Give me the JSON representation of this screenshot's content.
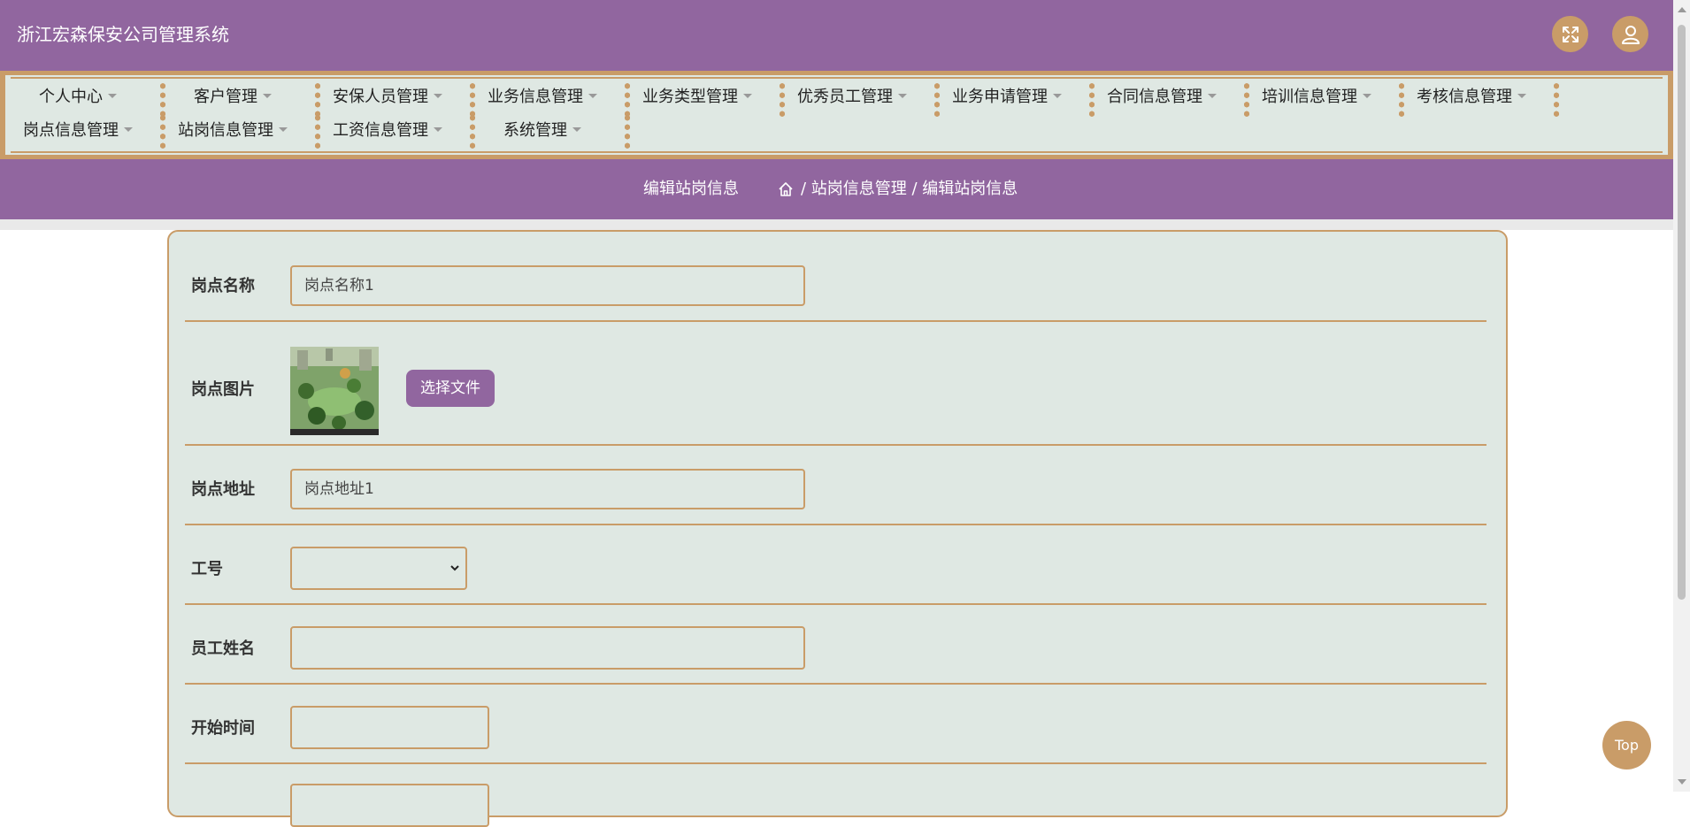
{
  "header": {
    "title": "浙江宏森保安公司管理系统",
    "fullscreen_icon": "expand-icon",
    "user_icon": "user-icon"
  },
  "nav": {
    "row1": [
      "个人中心",
      "客户管理",
      "安保人员管理",
      "业务信息管理",
      "业务类型管理",
      "优秀员工管理",
      "业务申请管理",
      "合同信息管理",
      "培训信息管理",
      "考核信息管理"
    ],
    "row2": [
      "岗点信息管理",
      "站岗信息管理",
      "工资信息管理",
      "系统管理"
    ]
  },
  "breadcrumb": {
    "page_title": "编辑站岗信息",
    "home_icon": "home-icon",
    "path": "/ 站岗信息管理 / 编辑站岗信息"
  },
  "form": {
    "post_name": {
      "label": "岗点名称",
      "value": "岗点名称1"
    },
    "post_image": {
      "label": "岗点图片",
      "button": "选择文件"
    },
    "post_address": {
      "label": "岗点地址",
      "value": "岗点地址1"
    },
    "employee_no": {
      "label": "工号",
      "value": ""
    },
    "employee_name": {
      "label": "员工姓名",
      "value": ""
    },
    "start_time": {
      "label": "开始时间",
      "value": ""
    }
  },
  "top_button": "Top",
  "colors": {
    "primary": "#91669f",
    "accent": "#c99c68",
    "panel": "#dfe8e3"
  }
}
